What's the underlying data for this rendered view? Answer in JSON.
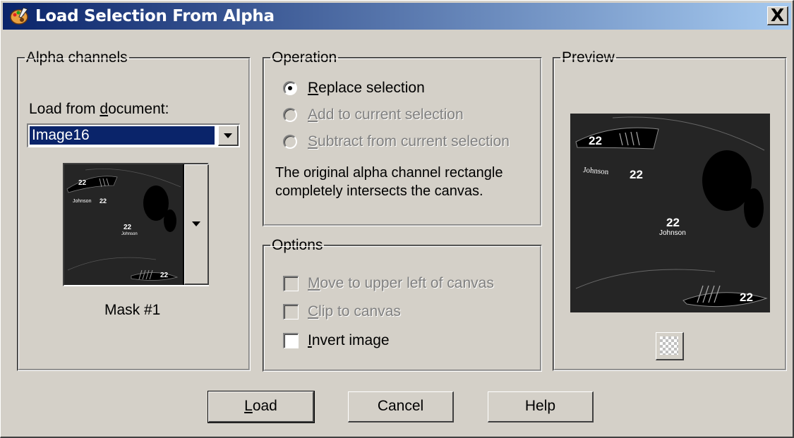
{
  "window": {
    "title": "Load Selection From Alpha",
    "close_symbol": "X"
  },
  "alpha_channels": {
    "legend": "Alpha channels",
    "load_from_prefix": "Load from ",
    "load_from_mnemonic": "d",
    "load_from_suffix": "ocument:",
    "document_value": "Image16",
    "mask_name": "Mask #1",
    "thumb_texts": [
      "22",
      "Johnson",
      "22",
      "22",
      "Johnson",
      "22"
    ]
  },
  "operation": {
    "legend": "Operation",
    "options": [
      {
        "mnemonic": "R",
        "rest": "eplace selection",
        "selected": true,
        "enabled": true
      },
      {
        "mnemonic": "A",
        "rest": "dd to current selection",
        "selected": false,
        "enabled": false
      },
      {
        "mnemonic": "S",
        "rest": "ubtract from current selection",
        "selected": false,
        "enabled": false
      }
    ],
    "info_line1": "The original alpha channel rectangle",
    "info_line2": "completely intersects the canvas."
  },
  "options": {
    "legend": "Options",
    "items": [
      {
        "mnemonic": "M",
        "rest": "ove to upper left of canvas",
        "checked": false,
        "enabled": false
      },
      {
        "mnemonic": "C",
        "rest": "lip to canvas",
        "checked": false,
        "enabled": false
      },
      {
        "mnemonic": "I",
        "rest": "nvert image",
        "checked": false,
        "enabled": true
      }
    ]
  },
  "preview": {
    "legend": "Preview",
    "texts": {
      "num_top": "22",
      "name_left": "Johnson",
      "num_left": "22",
      "num_center": "22",
      "name_center": "Johnson",
      "num_bottom": "22"
    }
  },
  "buttons": {
    "load_mnemonic": "L",
    "load_rest": "oad",
    "cancel": "Cancel",
    "help": "Help"
  },
  "colors": {
    "face": "#d4d0c8",
    "title_start": "#0a246a",
    "title_end": "#a6caf0",
    "selection": "#0a246a",
    "disabled_text": "#808080"
  }
}
